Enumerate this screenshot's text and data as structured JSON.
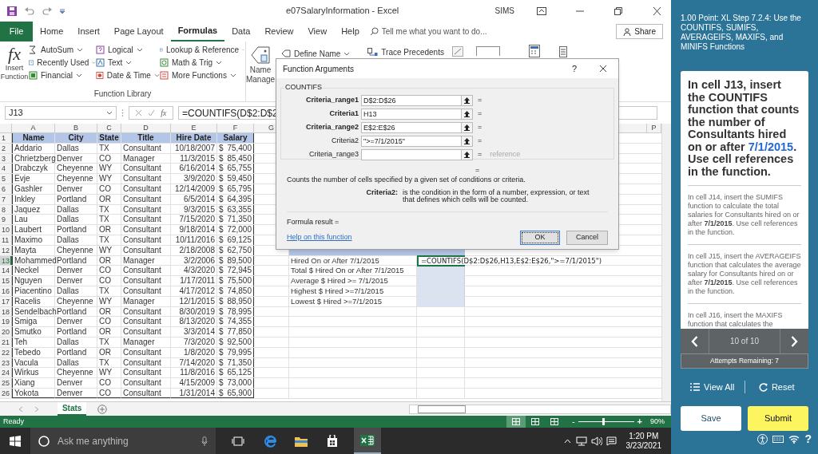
{
  "title_bar": {
    "title": "e07SalaryInformation - Excel",
    "user": "SIMS"
  },
  "ribbon_tabs": [
    {
      "label": "File",
      "kind": "file",
      "selected": false
    },
    {
      "label": "Home",
      "kind": "tab",
      "selected": false
    },
    {
      "label": "Insert",
      "kind": "tab",
      "selected": false
    },
    {
      "label": "Page Layout",
      "kind": "tab",
      "selected": false
    },
    {
      "label": "Formulas",
      "kind": "tab",
      "selected": true
    },
    {
      "label": "Data",
      "kind": "tab",
      "selected": false
    },
    {
      "label": "Review",
      "kind": "tab",
      "selected": false
    },
    {
      "label": "View",
      "kind": "tab",
      "selected": false
    },
    {
      "label": "Help",
      "kind": "tab",
      "selected": false
    }
  ],
  "tell_me": {
    "placeholder": "Tell me what you want to do..."
  },
  "share": "Share",
  "ribbon": {
    "function_symbol": "fx",
    "insert_function": "Insert Function",
    "function_columns": [
      [
        "AutoSum",
        "Recently Used",
        "Financial"
      ],
      [
        "Logical",
        "Text",
        "Date & Time"
      ],
      [
        "Lookup & Reference",
        "Math & Trig",
        "More Functions"
      ]
    ],
    "group_label": "Function Library",
    "name_manager": "Name Manage",
    "define_name": "Define Name",
    "trace_precedents": "Trace Precedents"
  },
  "formula_bar": {
    "name_box": "J13",
    "function_symbol": "fx",
    "formula": "=COUNTIFS(D$2:D$2"
  },
  "sheet": {
    "columns": [
      "A",
      "B",
      "C",
      "D",
      "E",
      "F",
      "G",
      "P"
    ],
    "rows": [
      {
        "num": "1",
        "kind": "header",
        "selected": false,
        "cells": [
          "Name",
          "City",
          "State",
          "Title",
          "Hire Date",
          "Salary"
        ]
      },
      {
        "num": "2",
        "kind": "data",
        "selected": false,
        "cells": [
          "Addario",
          "Dallas",
          "TX",
          "Consultant",
          "10/18/2007"
        ],
        "currency": "$",
        "salary": "75,400"
      },
      {
        "num": "3",
        "kind": "data",
        "selected": false,
        "cells": [
          "Chrietzberg",
          "Denver",
          "CO",
          "Manager",
          "11/3/2015"
        ],
        "currency": "$",
        "salary": "85,450"
      },
      {
        "num": "4",
        "kind": "data",
        "selected": false,
        "cells": [
          "Drabczyk",
          "Cheyenne",
          "WY",
          "Consultant",
          "6/16/2014"
        ],
        "currency": "$",
        "salary": "65,755"
      },
      {
        "num": "5",
        "kind": "data",
        "selected": false,
        "cells": [
          "Evje",
          "Cheyenne",
          "WY",
          "Consultant",
          "3/9/2020"
        ],
        "currency": "$",
        "salary": "59,450"
      },
      {
        "num": "6",
        "kind": "data",
        "selected": false,
        "cells": [
          "Gashler",
          "Denver",
          "CO",
          "Consultant",
          "12/14/2009"
        ],
        "currency": "$",
        "salary": "65,795"
      },
      {
        "num": "7",
        "kind": "data",
        "selected": false,
        "cells": [
          "Inkley",
          "Portland",
          "OR",
          "Consultant",
          "6/5/2014"
        ],
        "currency": "$",
        "salary": "64,395"
      },
      {
        "num": "8",
        "kind": "data",
        "selected": false,
        "cells": [
          "Jaquez",
          "Dallas",
          "TX",
          "Consultant",
          "9/3/2015"
        ],
        "currency": "$",
        "salary": "63,355"
      },
      {
        "num": "9",
        "kind": "data",
        "selected": false,
        "cells": [
          "Lau",
          "Dallas",
          "TX",
          "Consultant",
          "7/15/2020"
        ],
        "currency": "$",
        "salary": "71,350"
      },
      {
        "num": "10",
        "kind": "data",
        "selected": false,
        "cells": [
          "Laubert",
          "Portland",
          "OR",
          "Consultant",
          "9/18/2014"
        ],
        "currency": "$",
        "salary": "72,000"
      },
      {
        "num": "11",
        "kind": "data",
        "selected": false,
        "cells": [
          "Maximo",
          "Dallas",
          "TX",
          "Consultant",
          "10/11/2016"
        ],
        "currency": "$",
        "salary": "69,125"
      },
      {
        "num": "12",
        "kind": "data",
        "selected": false,
        "cells": [
          "Mayta",
          "Cheyenne",
          "WY",
          "Consultant",
          "2/18/2008"
        ],
        "currency": "$",
        "salary": "62,750"
      },
      {
        "num": "13",
        "kind": "data",
        "selected": true,
        "cells": [
          "Mohammed",
          "Portland",
          "OR",
          "Manager",
          "3/2/2006"
        ],
        "currency": "$",
        "salary": "89,500"
      },
      {
        "num": "14",
        "kind": "data",
        "selected": false,
        "cells": [
          "Neckel",
          "Denver",
          "CO",
          "Consultant",
          "4/3/2020"
        ],
        "currency": "$",
        "salary": "72,945"
      },
      {
        "num": "15",
        "kind": "data",
        "selected": false,
        "cells": [
          "Nguyen",
          "Denver",
          "CO",
          "Consultant",
          "1/17/2011"
        ],
        "currency": "$",
        "salary": "75,500"
      },
      {
        "num": "16",
        "kind": "data",
        "selected": false,
        "cells": [
          "Piacentino",
          "Dallas",
          "TX",
          "Consultant",
          "4/17/2012"
        ],
        "currency": "$",
        "salary": "74,850"
      },
      {
        "num": "17",
        "kind": "data",
        "selected": false,
        "cells": [
          "Racelis",
          "Cheyenne",
          "WY",
          "Manager",
          "12/1/2015"
        ],
        "currency": "$",
        "salary": "88,950"
      },
      {
        "num": "18",
        "kind": "data",
        "selected": false,
        "cells": [
          "Sendelbach",
          "Portland",
          "OR",
          "Consultant",
          "8/30/2019"
        ],
        "currency": "$",
        "salary": "78,995"
      },
      {
        "num": "19",
        "kind": "data",
        "selected": false,
        "cells": [
          "Smiga",
          "Denver",
          "CO",
          "Consultant",
          "8/13/2020"
        ],
        "currency": "$",
        "salary": "74,355"
      },
      {
        "num": "20",
        "kind": "data",
        "selected": false,
        "cells": [
          "Smutko",
          "Portland",
          "OR",
          "Consultant",
          "3/3/2014"
        ],
        "currency": "$",
        "salary": "77,850"
      },
      {
        "num": "21",
        "kind": "data",
        "selected": false,
        "cells": [
          "Teh",
          "Dallas",
          "TX",
          "Manager",
          "7/3/2020"
        ],
        "currency": "$",
        "salary": "92,500"
      },
      {
        "num": "22",
        "kind": "data",
        "selected": false,
        "cells": [
          "Tebedo",
          "Portland",
          "OR",
          "Consultant",
          "1/8/2020"
        ],
        "currency": "$",
        "salary": "79,995"
      },
      {
        "num": "23",
        "kind": "data",
        "selected": false,
        "cells": [
          "Vacula",
          "Dallas",
          "TX",
          "Consultant",
          "7/14/2020"
        ],
        "currency": "$",
        "salary": "71,350"
      },
      {
        "num": "24",
        "kind": "data",
        "selected": false,
        "cells": [
          "Wirkus",
          "Cheyenne",
          "WY",
          "Consultant",
          "11/8/2016"
        ],
        "currency": "$",
        "salary": "65,125"
      },
      {
        "num": "25",
        "kind": "data",
        "selected": false,
        "cells": [
          "Xiang",
          "Denver",
          "CO",
          "Consultant",
          "4/15/2009"
        ],
        "currency": "$",
        "salary": "73,000"
      },
      {
        "num": "26",
        "kind": "data",
        "selected": false,
        "cells": [
          "Yokota",
          "Denver",
          "CO",
          "Consultant",
          "1/31/2014"
        ],
        "currency": "$",
        "salary": "65,900"
      }
    ],
    "summary": {
      "labels": [
        "Hired On or After 7/1/2015",
        "Total $ Hired On or After 7/1/2015",
        "Average $ Hired >= 7/1/2015",
        "Highest $ Hired >=7/1/2015",
        "Lowest $ Hired >=7/1/2015"
      ],
      "formula": "=COUNTIFS(D$2:D$26,H13,E$2:E$26,\">=7/1/2015\")"
    }
  },
  "sheet_tabs": [
    {
      "label": "Stats",
      "selected": true
    }
  ],
  "status_bar": {
    "status": "Ready",
    "views": [
      {
        "selected": true
      },
      {
        "selected": false
      },
      {
        "selected": false
      }
    ],
    "zoom_out": "-",
    "zoom_slider": {
      "level": 0.45
    },
    "zoom_in": "+",
    "zoom": "90%"
  },
  "taskbar": {
    "search": {
      "placeholder": "Ask me anything"
    },
    "time": "1:20 PM",
    "date": "3/23/2021"
  },
  "dialog": {
    "title": "Function Arguments",
    "help": "?",
    "function": "COUNTIFS",
    "args": [
      {
        "label": "Criteria_range1",
        "required": true,
        "value": "D$2:D$26",
        "sign": "="
      },
      {
        "label": "Criteria1",
        "required": true,
        "value": "H13",
        "sign": "="
      },
      {
        "label": "Criteria_range2",
        "required": true,
        "value": "E$2:E$26",
        "sign": "="
      },
      {
        "label": "Criteria2",
        "required": false,
        "value": "\">=7/1/2015\"",
        "sign": "="
      },
      {
        "label": "Criteria_range3",
        "required": false,
        "sign": "=",
        "hint": "reference"
      }
    ],
    "result_sign": "=",
    "description": "Counts the number of cells specified by a given set of conditions or criteria.",
    "arg_help_label": "Criteria2:",
    "arg_help": "is the condition in the form of a number, expression, or text that defines which cells will be counted.",
    "formula_result": "Formula result =",
    "help_link": "Help on this function",
    "buttons": [
      "OK",
      "Cancel"
    ]
  },
  "panel": {
    "header": "1.00 Point: XL Step 7.2.4: Use the COUNTIFS, SUMIFS, AVERAGEIFS, MAXIFS, and MINIFS Functions",
    "tasks": [
      {
        "current": true,
        "before": "In cell J13, insert the COUNTIFS function that counts the number of Consultants hired on or after ",
        "date": "7/1/2015",
        "after": ". Use cell references in the function."
      },
      {
        "current": false,
        "before": "In cell J14, insert the SUMIFS function to calculate the total salaries for Consultants hired on or after ",
        "date": "7/1/2015",
        "after": ". Use cell references in the function."
      },
      {
        "current": false,
        "before": "In cell J15, insert the AVERAGEIFS function that calculates the average salary for Consultants hired on or after ",
        "date": "7/1/2015",
        "after": ". Use cell references in the function."
      },
      {
        "current": false,
        "before": "In cell J16, insert the MAXIFS function that calculates the"
      }
    ],
    "position": "10 of 10",
    "attempts": "Attempts Remaining: 7",
    "view_all": "View All",
    "reset": "Reset",
    "save": "Save",
    "submit": "Submit",
    "help": "?"
  }
}
